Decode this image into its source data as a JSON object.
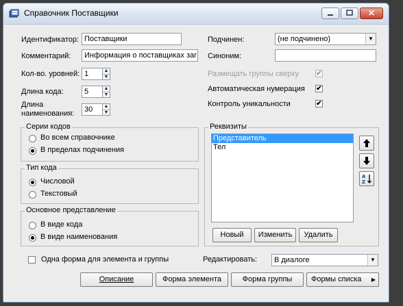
{
  "window": {
    "title": "Справочник Поставщики",
    "close_glyph": "✕"
  },
  "left": {
    "identifier_label": "Идентификатор:",
    "identifier_value": "Поставщики",
    "comment_label": "Комментарий:",
    "comment_value": "Информация о поставщиках заг",
    "levels_label": "Кол-во. уровней:",
    "levels_value": "1",
    "code_length_label": "Длина кода:",
    "code_length_value": "5",
    "name_length_label_1": "Длина",
    "name_length_label_2": "наименования:",
    "name_length_value": "30"
  },
  "right": {
    "subordinate_label": "Подчинен:",
    "subordinate_value": "(не подчинено)",
    "synonym_label": "Синоним:",
    "synonym_value": "",
    "groups_top_label": "Размещать группы сверху",
    "auto_numbering_label": "Автоматическая нумерация",
    "uniqueness_label": "Контроль уникальности",
    "check_glyph": "✔"
  },
  "code_series": {
    "title": "Серии кодов",
    "options": [
      "Во всем справочнике",
      "В пределах подчинения"
    ],
    "selected": 1
  },
  "code_type": {
    "title": "Тип кода",
    "options": [
      "Числовой",
      "Текстовый"
    ],
    "selected": 0
  },
  "main_repr": {
    "title": "Основное представление",
    "options": [
      "В виде кода",
      "В виде наименования"
    ],
    "selected": 1
  },
  "requisites": {
    "title": "Реквизиты",
    "items": [
      "Представитель",
      "Тел"
    ],
    "selected": 0,
    "buttons": {
      "new": "Новый",
      "edit": "Изменить",
      "delete": "Удалить"
    }
  },
  "bottom": {
    "one_form_label": "Одна форма для элемента и группы",
    "edit_label": "Редактировать:",
    "edit_value": "В диалоге",
    "buttons": {
      "description": "Описание",
      "element_form": "Форма элемента",
      "group_form": "Форма группы",
      "list_forms": "Формы списка"
    }
  }
}
